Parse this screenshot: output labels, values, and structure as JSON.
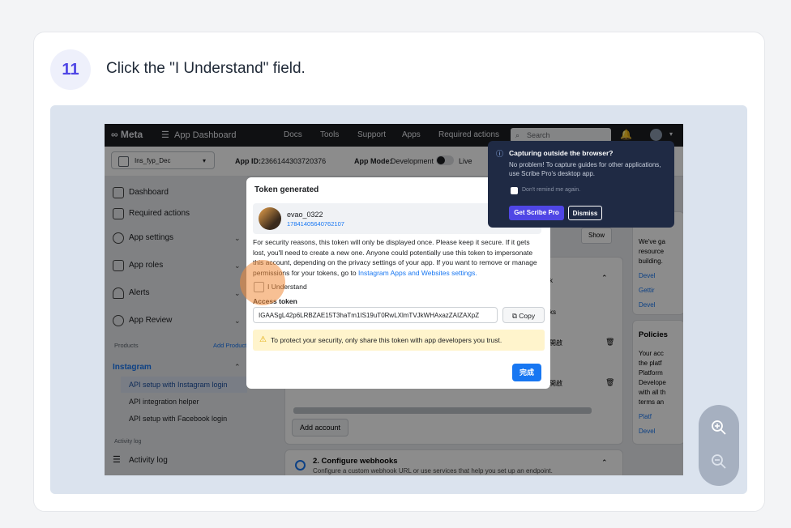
{
  "step": {
    "number": "11",
    "title": "Click the \"I Understand\" field."
  },
  "topbar": {
    "logo": "Meta",
    "menu": "App Dashboard",
    "nav": [
      "Docs",
      "Tools",
      "Support",
      "Apps",
      "Required actions"
    ],
    "search_placeholder": "Search"
  },
  "subbar": {
    "app_select": "Ins_fyp_Dec",
    "app_id_label": "App ID:",
    "app_id_value": "2366144303720376",
    "app_mode_label": "App Mode:",
    "app_mode_value": "Development",
    "live_label": "Live"
  },
  "sidebar": {
    "items": [
      "Dashboard",
      "Required actions",
      "App settings",
      "App roles",
      "Alerts",
      "App Review"
    ],
    "products_label": "Products",
    "add_product": "Add Product",
    "instagram_label": "Instagram",
    "sub_items": [
      "API setup with Instagram login",
      "API integration helper",
      "API setup with Facebook login"
    ],
    "activity_label": "Activity log",
    "activity_item": "Activity log"
  },
  "main": {
    "show_button": "Show",
    "add_account": "Add account",
    "configure_title": "2. Configure webhooks",
    "configure_desc": "Configure a custom webhook URL or use services that help you set up an endpoint.",
    "right_fragments": [
      "We've ga",
      "resource",
      "building.",
      "Devel",
      "Gettir",
      "Devel"
    ],
    "policies_title": "Policies",
    "policies_fragments": [
      "Your acc",
      "the platf",
      "Platform",
      "Develope",
      "with all th",
      "terms an",
      "Platf",
      "Devel"
    ],
    "row_fragments": [
      "k",
      "ks",
      "開啟",
      "開啟"
    ]
  },
  "modal": {
    "title": "Token generated",
    "username": "evao_0322",
    "user_id": "17841405640762107",
    "message": "For security reasons, this token will only be displayed once. Please keep it secure. If it gets lost, you'll need to create a new one. Anyone could potentially use this token to impersonate this account, depending on the privacy settings of your app. If you want to remove or manage permissions for your tokens, go to",
    "link": "Instagram Apps and Websites settings.",
    "checkbox_label": "I Understand",
    "access_token_label": "Access token",
    "access_token_value": "IGAASgL42p6LRBZAE15T3haTm1IS19uT0RwLXlmTVJkWHAxazZAIZAXpZ",
    "copy_label": "Copy",
    "notice": "To protect your security, only share this token with app developers you trust.",
    "done_label": "完成"
  },
  "scribe_popup": {
    "title": "Capturing outside the browser?",
    "body": "No problem! To capture guides for other applications, use Scribe Pro's desktop app.",
    "checkbox_label": "Don't remind me again.",
    "primary_button": "Get Scribe Pro",
    "secondary_button": "Dismiss"
  },
  "colors": {
    "accent": "#4f46e5",
    "meta_blue": "#1877f2",
    "highlight": "#f08c3c"
  }
}
